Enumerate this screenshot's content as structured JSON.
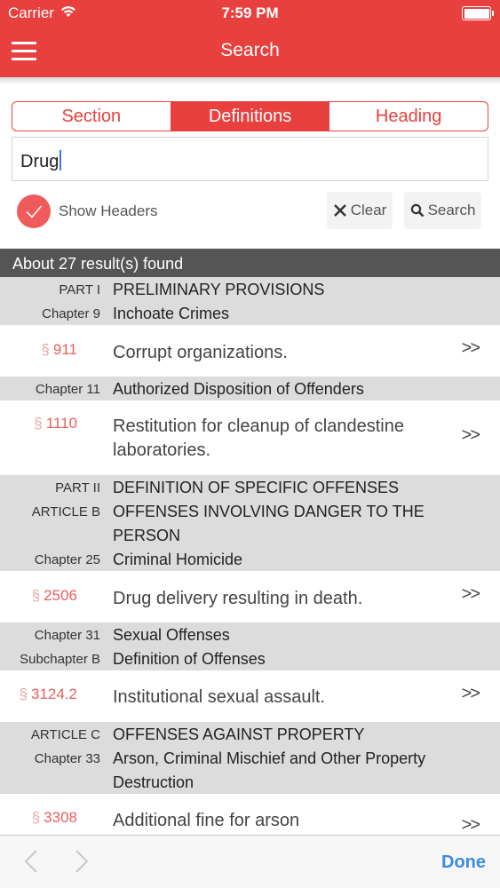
{
  "status": {
    "carrier": "Carrier",
    "time": "7:59 PM"
  },
  "nav": {
    "title": "Search"
  },
  "tabs": [
    "Section",
    "Definitions",
    "Heading"
  ],
  "search": {
    "value": "Drug"
  },
  "controls": {
    "show_headers": "Show Headers",
    "clear": "Clear",
    "search": "Search"
  },
  "results": {
    "summary": "About 27 result(s) found"
  },
  "list": [
    {
      "type": "header",
      "rows": [
        {
          "label": "PART I",
          "text": "PRELIMINARY PROVISIONS"
        },
        {
          "label": "Chapter 9",
          "text": "Inchoate Crimes"
        }
      ]
    },
    {
      "type": "section",
      "symbol": "§",
      "number": "911",
      "title": "Corrupt organizations.",
      "chevron": ">>"
    },
    {
      "type": "header",
      "rows": [
        {
          "label": "Chapter 11",
          "text": "Authorized Disposition of Offenders"
        }
      ]
    },
    {
      "type": "section",
      "symbol": "§",
      "number": "1110",
      "title": "Restitution for cleanup of clandestine laboratories.",
      "chevron": ">>"
    },
    {
      "type": "header",
      "rows": [
        {
          "label": "PART II",
          "text": "DEFINITION OF SPECIFIC OFFENSES"
        },
        {
          "label": "ARTICLE B",
          "text": "OFFENSES INVOLVING DANGER TO THE PERSON"
        },
        {
          "label": "Chapter 25",
          "text": "Criminal Homicide"
        }
      ]
    },
    {
      "type": "section",
      "symbol": "§",
      "number": "2506",
      "title": "Drug delivery resulting in death.",
      "chevron": ">>"
    },
    {
      "type": "header",
      "rows": [
        {
          "label": "Chapter 31",
          "text": "Sexual Offenses"
        },
        {
          "label": "Subchapter B",
          "text": "Definition of Offenses"
        }
      ]
    },
    {
      "type": "section",
      "symbol": "§",
      "number": "3124.2",
      "title": "Institutional sexual assault.",
      "chevron": ">>"
    },
    {
      "type": "header",
      "rows": [
        {
          "label": "ARTICLE C",
          "text": "OFFENSES AGAINST PROPERTY"
        },
        {
          "label": "Chapter 33",
          "text": "Arson, Criminal Mischief and Other Property Destruction"
        }
      ]
    },
    {
      "type": "section",
      "symbol": "§",
      "number": "3308",
      "title": "Additional fine for arson",
      "chevron": ">>"
    }
  ],
  "toolbar": {
    "done": "Done"
  },
  "colors": {
    "accent": "#e8403e",
    "header_bg": "#dcdcdd",
    "results_bar": "#555555",
    "link": "#3a8be3"
  }
}
